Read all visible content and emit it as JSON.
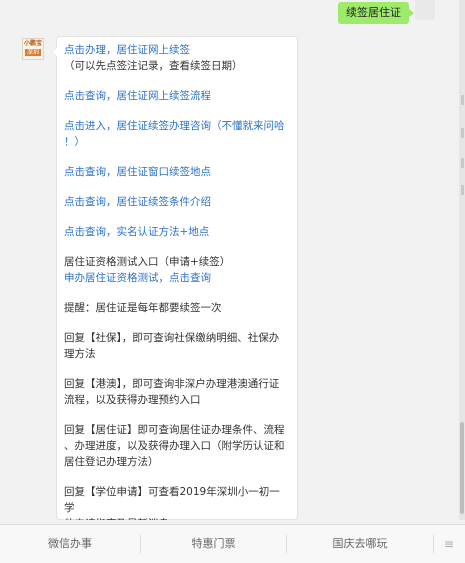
{
  "outgoing": {
    "text": "续签居住证"
  },
  "avatar": {
    "line1": "小鹏宝",
    "line2": "深圳"
  },
  "message": {
    "paragraphs": [
      {
        "lines": [
          {
            "text": "点击办理，居住证网上续签",
            "type": "link"
          },
          {
            "text": "（可以先点签注记录，查看续签日期）",
            "type": "plain"
          }
        ]
      },
      {
        "lines": [
          {
            "text": "点击查询，居住证网上续签流程",
            "type": "link"
          }
        ]
      },
      {
        "lines": [
          {
            "text": "点击进入，居住证续签办理咨询（不懂就来问哈",
            "type": "link"
          },
          {
            "text": "！）",
            "type": "link"
          }
        ]
      },
      {
        "lines": [
          {
            "text": "点击查询，居住证窗口续签地点",
            "type": "link"
          }
        ]
      },
      {
        "lines": [
          {
            "text": "点击查询，居住证续签条件介绍",
            "type": "link"
          }
        ]
      },
      {
        "lines": [
          {
            "text": "点击查询，实名认证方法+地点",
            "type": "link"
          }
        ]
      },
      {
        "lines": [
          {
            "text": "居住证资格测试入口（申请+续签）",
            "type": "plain"
          },
          {
            "text": "申办居住证资格测试，点击查询",
            "type": "link"
          }
        ]
      },
      {
        "lines": [
          {
            "text": "提醒：居住证是每年都要续签一次",
            "type": "plain"
          }
        ]
      },
      {
        "lines": [
          {
            "text": "回复【社保】，即可查询社保缴纳明细、社保办",
            "type": "plain"
          },
          {
            "text": "理方法",
            "type": "plain"
          }
        ]
      },
      {
        "lines": [
          {
            "text": "回复【港澳】，即可查询非深户办理港澳通行证",
            "type": "plain"
          },
          {
            "text": "流程，以及获得办理预约入口",
            "type": "plain"
          }
        ]
      },
      {
        "lines": [
          {
            "text": "回复【居住证】即可查询居住证办理条件、流程",
            "type": "plain"
          },
          {
            "text": "、办理进度，以及获得办理入口（附学历认证和",
            "type": "plain"
          },
          {
            "text": "居住登记办理方法）",
            "type": "plain"
          }
        ]
      },
      {
        "lines": [
          {
            "text": "回复【学位申请】可查看2019年深圳小一初一学",
            "type": "plain"
          },
          {
            "text": "位申请指南及最新消息",
            "type": "plain"
          }
        ]
      }
    ]
  },
  "menu": {
    "items": [
      {
        "label": "微信办事"
      },
      {
        "label": "特惠门票"
      },
      {
        "label": "国庆去哪玩"
      }
    ],
    "keyboard_icon": "≡"
  }
}
